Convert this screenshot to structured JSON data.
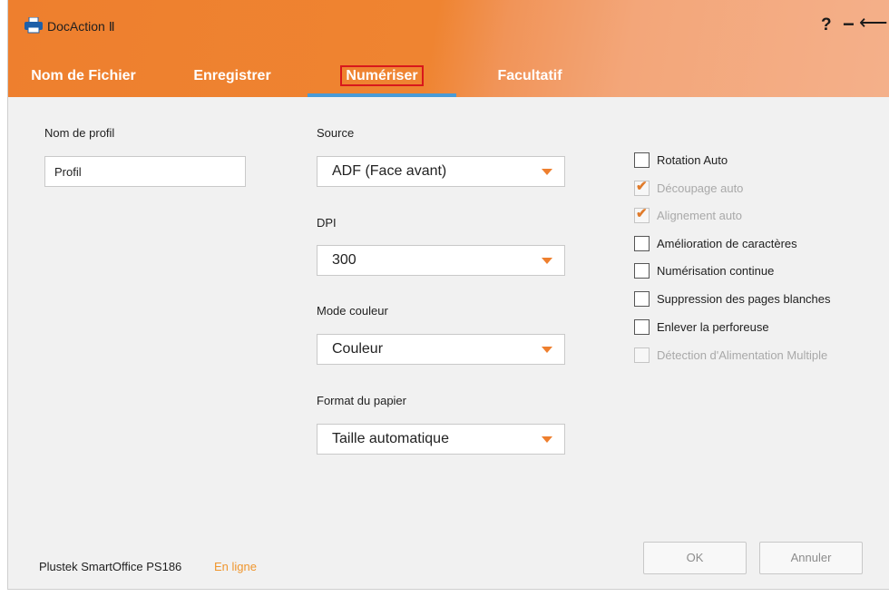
{
  "window": {
    "title": "DocAction Ⅱ",
    "icon": "printer-icon",
    "controls": {
      "help": "?",
      "minimize": "−",
      "back": "⟵"
    }
  },
  "tabs": [
    {
      "label": "Nom de Fichier",
      "active": false
    },
    {
      "label": "Enregistrer",
      "active": false
    },
    {
      "label": "Numériser",
      "active": true
    },
    {
      "label": "Facultatif",
      "active": false
    }
  ],
  "profile": {
    "label": "Nom de profil",
    "value": "Profil"
  },
  "scan": {
    "source": {
      "label": "Source",
      "value": "ADF (Face avant)"
    },
    "dpi": {
      "label": "DPI",
      "value": "300"
    },
    "color_mode": {
      "label": "Mode couleur",
      "value": "Couleur"
    },
    "paper_size": {
      "label": "Format du papier",
      "value": "Taille automatique"
    }
  },
  "options": [
    {
      "label": "Rotation Auto",
      "checked": false,
      "disabled": false
    },
    {
      "label": "Découpage auto",
      "checked": true,
      "disabled": true
    },
    {
      "label": "Alignement auto",
      "checked": true,
      "disabled": true
    },
    {
      "label": "Amélioration de caractères",
      "checked": false,
      "disabled": false
    },
    {
      "label": "Numérisation continue",
      "checked": false,
      "disabled": false
    },
    {
      "label": "Suppression des pages blanches",
      "checked": false,
      "disabled": false
    },
    {
      "label": "Enlever la perforeuse",
      "checked": false,
      "disabled": false
    },
    {
      "label": "Détection d'Alimentation Multiple",
      "checked": false,
      "disabled": true
    }
  ],
  "footer": {
    "device": "Plustek SmartOffice PS186",
    "status": "En ligne",
    "ok_label": "OK",
    "cancel_label": "Annuler"
  },
  "colors": {
    "accent": "#ee7f2e",
    "tab_underline": "#4a9bd6",
    "active_tab_outline": "#d8181c",
    "status": "#f0962e"
  }
}
